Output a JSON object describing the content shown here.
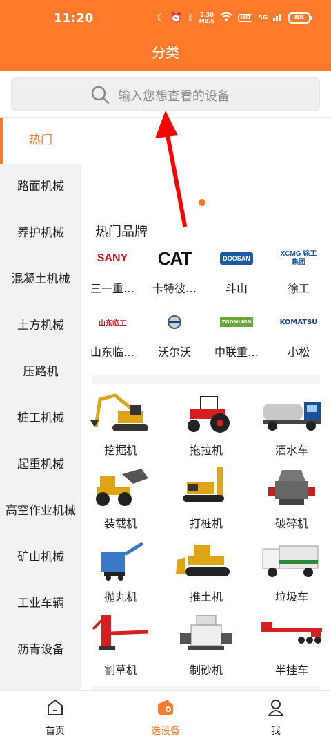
{
  "status": {
    "time": "11:20",
    "net_speed_value": "2.30",
    "net_speed_unit": "MB/S",
    "hd": "HD",
    "signal": "5G",
    "battery": "88"
  },
  "header": {
    "title": "分类"
  },
  "search": {
    "placeholder": "输入您想查看的设备"
  },
  "sidebar": {
    "items": [
      {
        "label": "热门",
        "active": true
      },
      {
        "label": "路面机械"
      },
      {
        "label": "养护机械"
      },
      {
        "label": "混凝土机械"
      },
      {
        "label": "土方机械"
      },
      {
        "label": "压路机"
      },
      {
        "label": "桩工机械"
      },
      {
        "label": "起重机械"
      },
      {
        "label": "高空作业机械"
      },
      {
        "label": "矿山机械"
      },
      {
        "label": "工业车辆"
      },
      {
        "label": "沥青设备"
      }
    ]
  },
  "hot_brands": {
    "title": "热门品牌",
    "items": [
      {
        "logo_text": "SANY",
        "name": "三一重…",
        "color": "#d8141c"
      },
      {
        "logo_text": "CAT",
        "name": "卡特彼…",
        "color": "#111111"
      },
      {
        "logo_text": "DOOSAN",
        "name": "斗山",
        "color": "#1b5aa6"
      },
      {
        "logo_text": "XCMG 徐工集团",
        "name": "徐工",
        "color": "#1b5aa6"
      },
      {
        "logo_text": "山东临工",
        "name": "山东临…",
        "color": "#c8161e"
      },
      {
        "logo_text": "VOLVO",
        "name": "沃尔沃",
        "color": "#4a5a6a"
      },
      {
        "logo_text": "ZOOMLION",
        "name": "中联重…",
        "color": "#6aa83a"
      },
      {
        "logo_text": "KOMATSU",
        "name": "小松",
        "color": "#1b3f9a"
      }
    ]
  },
  "equipment": {
    "items": [
      {
        "name": "挖掘机",
        "icon": "excavator-icon"
      },
      {
        "name": "拖拉机",
        "icon": "tractor-icon"
      },
      {
        "name": "洒水车",
        "icon": "water-truck-icon"
      },
      {
        "name": "装载机",
        "icon": "loader-icon"
      },
      {
        "name": "打桩机",
        "icon": "pile-driver-icon"
      },
      {
        "name": "破碎机",
        "icon": "crusher-icon"
      },
      {
        "name": "抛丸机",
        "icon": "shot-blaster-icon"
      },
      {
        "name": "推土机",
        "icon": "bulldozer-icon"
      },
      {
        "name": "垃圾车",
        "icon": "garbage-truck-icon"
      },
      {
        "name": "割草机",
        "icon": "mower-icon"
      },
      {
        "name": "制砂机",
        "icon": "sand-maker-icon"
      },
      {
        "name": "半挂车",
        "icon": "semi-trailer-icon"
      }
    ]
  },
  "tabbar": {
    "items": [
      {
        "label": "首页",
        "icon": "home-icon"
      },
      {
        "label": "选设备",
        "icon": "wallet-icon",
        "active": true
      },
      {
        "label": "我",
        "icon": "user-icon"
      }
    ]
  },
  "colors": {
    "accent": "#ff7a2a",
    "annotation_arrow": "#ff0000"
  }
}
